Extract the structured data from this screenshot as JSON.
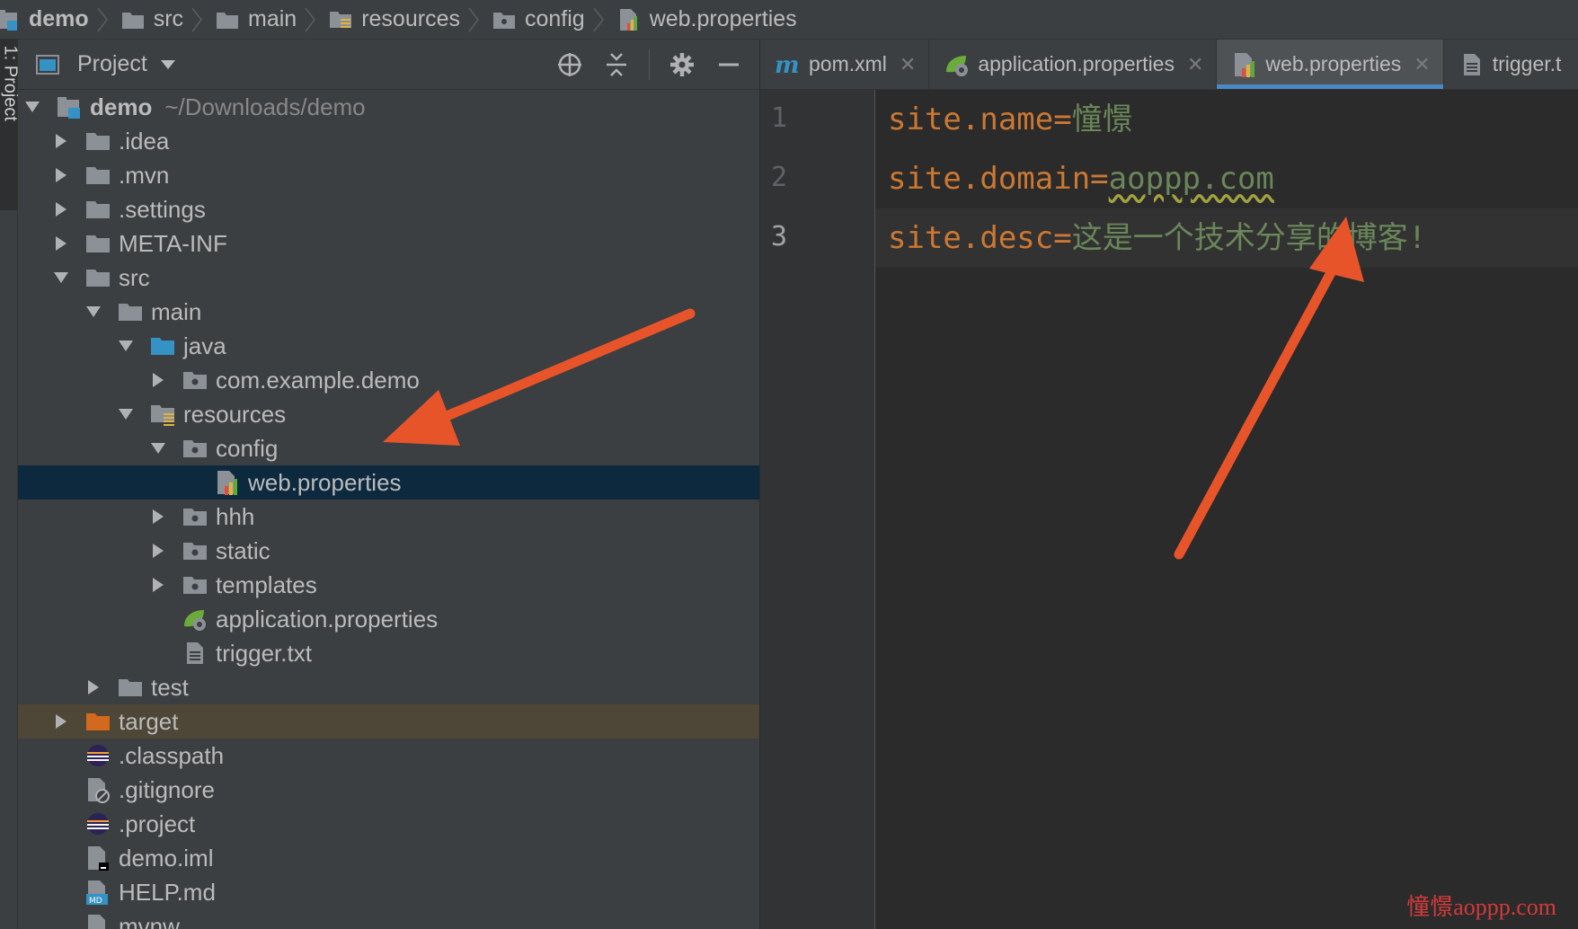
{
  "breadcrumb": {
    "items": [
      {
        "label": "demo",
        "icon": "module-icon"
      },
      {
        "label": "src",
        "icon": "folder-icon"
      },
      {
        "label": "main",
        "icon": "folder-icon"
      },
      {
        "label": "resources",
        "icon": "resources-folder-icon"
      },
      {
        "label": "config",
        "icon": "package-folder-icon"
      },
      {
        "label": "web.properties",
        "icon": "properties-file-icon"
      }
    ]
  },
  "tool_window": {
    "side_tab": "1: Project",
    "title": "Project",
    "tools": [
      "locate-icon",
      "collapse-all-icon",
      "gear-icon",
      "hide-icon"
    ]
  },
  "tree": {
    "root": {
      "label": "demo",
      "path": "~/Downloads/demo"
    },
    "items": [
      {
        "label": ".idea"
      },
      {
        "label": ".mvn"
      },
      {
        "label": ".settings"
      },
      {
        "label": "META-INF"
      },
      {
        "label": "src"
      },
      {
        "label": "main"
      },
      {
        "label": "java"
      },
      {
        "label": "com.example.demo"
      },
      {
        "label": "resources"
      },
      {
        "label": "config"
      },
      {
        "label": "web.properties"
      },
      {
        "label": "hhh"
      },
      {
        "label": "static"
      },
      {
        "label": "templates"
      },
      {
        "label": "application.properties"
      },
      {
        "label": "trigger.txt"
      },
      {
        "label": "test"
      },
      {
        "label": "target"
      },
      {
        "label": ".classpath"
      },
      {
        "label": ".gitignore"
      },
      {
        "label": ".project"
      },
      {
        "label": "demo.iml"
      },
      {
        "label": "HELP.md"
      },
      {
        "label": "mvnw"
      }
    ]
  },
  "editor": {
    "tabs": [
      {
        "label": "pom.xml",
        "icon": "maven-icon",
        "active": false
      },
      {
        "label": "application.properties",
        "icon": "spring-properties-icon",
        "active": false
      },
      {
        "label": "web.properties",
        "icon": "properties-file-icon",
        "active": true
      },
      {
        "label": "trigger.t",
        "icon": "text-file-icon",
        "active": false
      }
    ],
    "lines": [
      {
        "num": "1",
        "key": "site.name",
        "eq": "=",
        "value": "憧憬"
      },
      {
        "num": "2",
        "key": "site.domain",
        "eq": "=",
        "value": "aoppp.com"
      },
      {
        "num": "3",
        "key": "site.desc",
        "eq": "=",
        "value": "这是一个技术分享的博客!"
      }
    ]
  },
  "watermark": "憧憬aoppp.com",
  "colors": {
    "accent": "#4a88c7",
    "annotation_arrow": "#e8542a",
    "key": "#cc7832",
    "value": "#6a8759",
    "selection": "#0d293e",
    "excluded": "#4e4637",
    "watermark": "#d33a3a"
  }
}
